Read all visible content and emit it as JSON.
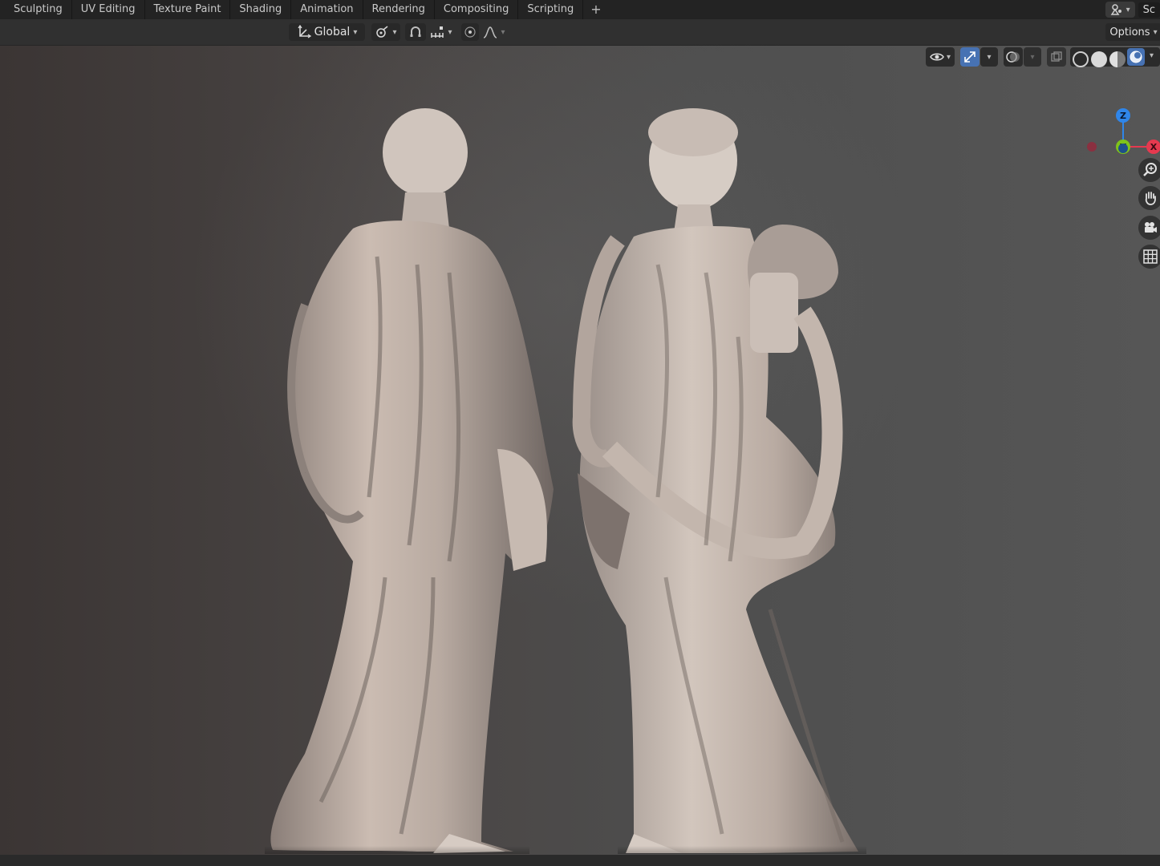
{
  "workspace_tabs": [
    "Sculpting",
    "UV Editing",
    "Texture Paint",
    "Shading",
    "Animation",
    "Rendering",
    "Compositing",
    "Scripting"
  ],
  "add_tab": "+",
  "scene_label": "Sc",
  "header": {
    "orientation": "Global",
    "options": "Options"
  },
  "gizmo": {
    "z": "Z",
    "y": "Y",
    "x": "X"
  },
  "colors": {
    "accent": "#4772b3",
    "axis_x": "#e6394f",
    "axis_y": "#7fc31a",
    "axis_z": "#2f86ea"
  },
  "icons": {
    "transform_orientation": "transform-orientation-icon",
    "pivot": "pivot-icon",
    "snap": "snap-icon",
    "snap_increment": "snap-increment-icon",
    "proportional": "proportional-edit-icon",
    "falloff": "falloff-curve-icon",
    "visibility": "eye-icon",
    "gizmo_toggle": "gizmo-toggle-icon",
    "overlays": "overlays-icon",
    "xray": "xray-icon",
    "zoom": "zoom-icon",
    "pan": "hand-icon",
    "camera": "camera-icon",
    "ortho": "grid-icon"
  }
}
